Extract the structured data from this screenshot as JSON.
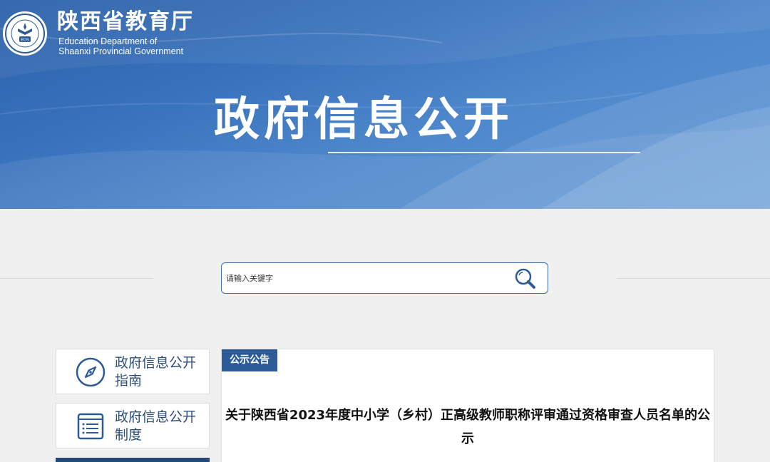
{
  "header": {
    "logo_cn": "陕西省教育厅",
    "logo_en_line1": "Education Department of",
    "logo_en_line2": "Shaanxi Provincial Government",
    "logo_seal_text": "EDS",
    "banner_title": "政府信息公开"
  },
  "search": {
    "placeholder": "请输入关键字"
  },
  "sidebar": {
    "items": [
      {
        "label": "政府信息公开指南",
        "icon": "compass-icon"
      },
      {
        "label": "政府信息公开制度",
        "icon": "document-list-icon"
      }
    ]
  },
  "notice": {
    "tab_label": "公示公告",
    "title": "关于陕西省2023年度中小学（乡村）正高级教师职称评审通过资格审查人员名单的公示"
  },
  "colors": {
    "banner_blue": "#3a74bd",
    "dark_blue": "#2d5b97",
    "sidebar_text": "#2b4e7a",
    "page_bg": "#f0f0f0"
  }
}
